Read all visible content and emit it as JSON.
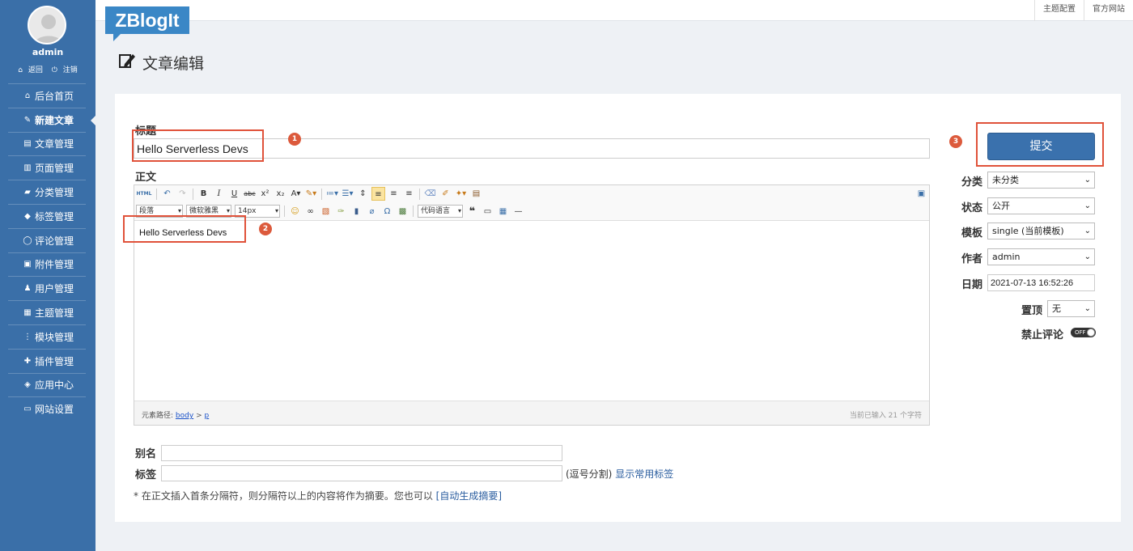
{
  "sidebar": {
    "username": "admin",
    "back_label": "返回",
    "logout_label": "注销",
    "items": [
      {
        "label": "后台首页"
      },
      {
        "label": "新建文章"
      },
      {
        "label": "文章管理"
      },
      {
        "label": "页面管理"
      },
      {
        "label": "分类管理"
      },
      {
        "label": "标签管理"
      },
      {
        "label": "评论管理"
      },
      {
        "label": "附件管理"
      },
      {
        "label": "用户管理"
      },
      {
        "label": "主题管理"
      },
      {
        "label": "模块管理"
      },
      {
        "label": "插件管理"
      },
      {
        "label": "应用中心"
      },
      {
        "label": "网站设置"
      }
    ]
  },
  "header": {
    "logo_text": "ZBlogIt",
    "links": [
      "主题配置",
      "官方网站"
    ]
  },
  "page": {
    "title": "文章编辑"
  },
  "form": {
    "title_label": "标题",
    "title_value": "Hello Serverless Devs",
    "body_label": "正文",
    "body_text": "Hello Serverless Devs",
    "alias_label": "别名",
    "alias_value": "",
    "tags_label": "标签",
    "tags_value": "",
    "tags_hint": "(逗号分割)",
    "tags_link": "显示常用标签",
    "note_text": "* 在正文插入首条分隔符，则分隔符以上的内容将作为摘要。您也可以",
    "note_link": "[自动生成摘要]"
  },
  "editor": {
    "toolbar": {
      "html_label": "HTML",
      "paragraph_select": "段落",
      "font_select": "微软雅黑",
      "size_select": "14px",
      "code_lang_select": "代码语言"
    },
    "status": {
      "path_label": "元素路径:",
      "path_body": "body",
      "path_sep": ">",
      "path_p": "p",
      "char_count": "当前已输入 21 个字符"
    }
  },
  "markers": [
    "1",
    "2",
    "3"
  ],
  "side": {
    "submit_label": "提交",
    "category_label": "分类",
    "category_value": "未分类",
    "status_label": "状态",
    "status_value": "公开",
    "template_label": "模板",
    "template_value": "single (当前模板)",
    "author_label": "作者",
    "author_value": "admin",
    "date_label": "日期",
    "date_value": "2021-07-13 16:52:26",
    "top_label": "置顶",
    "top_value": "无",
    "no_comment_label": "禁止评论",
    "no_comment_toggle": "OFF"
  },
  "colors": {
    "sidebar": "#3a6fa8",
    "logo": "#3a87c6",
    "submit": "#3a71ad",
    "annotation": "#e0523a"
  }
}
